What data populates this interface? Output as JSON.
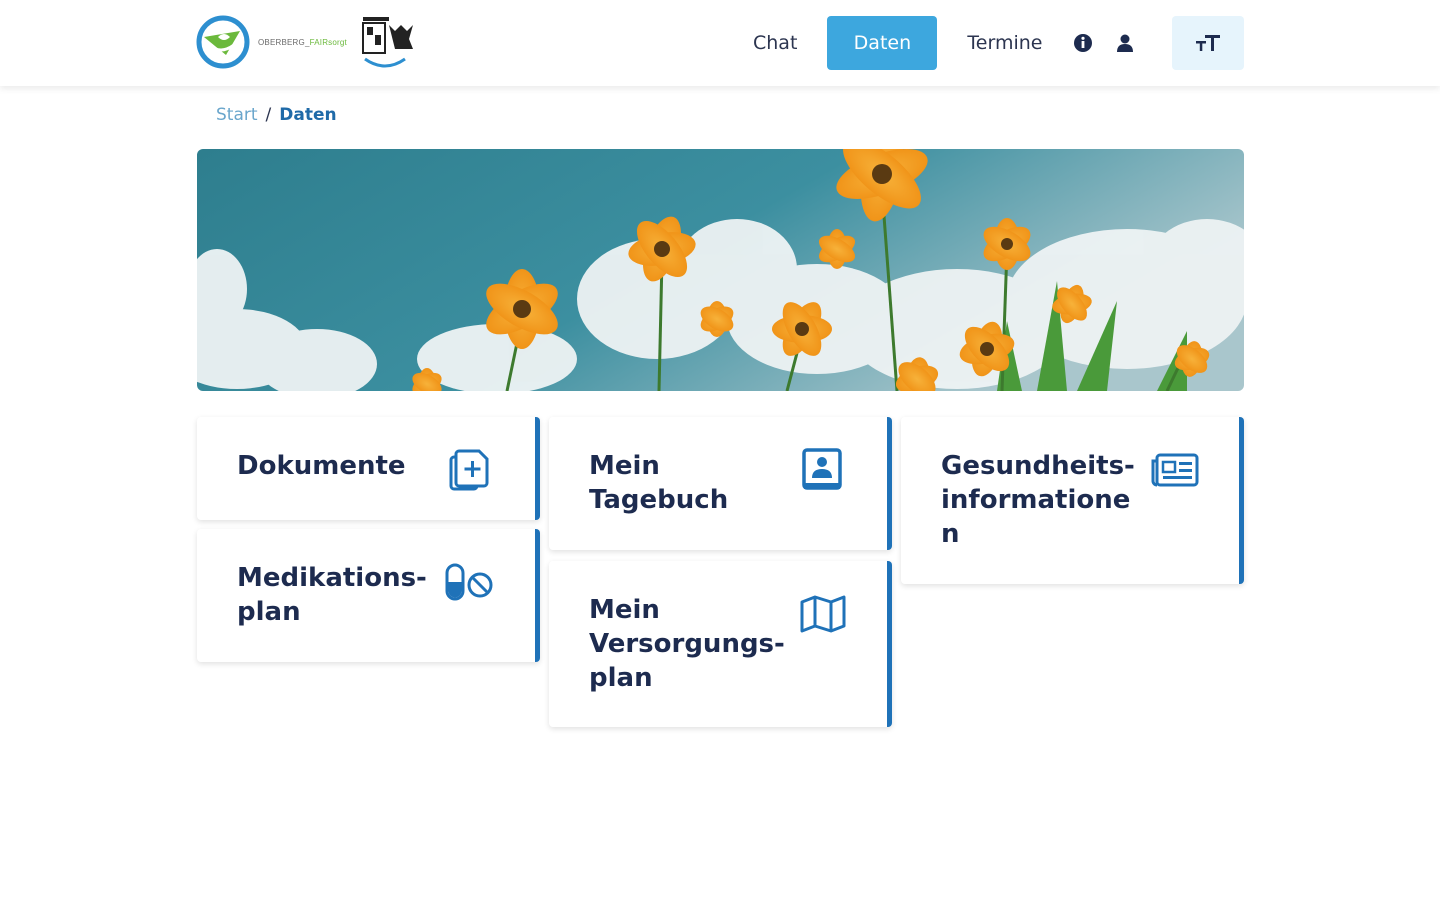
{
  "header": {
    "logo_text_a": "OBERBERG_",
    "logo_text_b": "FAIRsorgt",
    "nav": [
      {
        "label": "Chat"
      },
      {
        "label": "Daten",
        "active": true
      },
      {
        "label": "Termine"
      }
    ],
    "icons": [
      "info-icon",
      "user-icon",
      "font-size-icon"
    ]
  },
  "breadcrumb": {
    "start": "Start",
    "separator": "/",
    "current": "Daten"
  },
  "cards": {
    "dokumente": "Dokumente",
    "tagebuch": "Mein\nTagebuch",
    "gesundheit": "Gesundheits-\ninformatione\nn",
    "medikation": "Medikations-\nplan",
    "versorgung": "Mein\nVersorgungs-\nplan"
  },
  "colors": {
    "accent": "#3da7de",
    "card_border": "#1f72b8",
    "text": "#1d2b4f"
  }
}
